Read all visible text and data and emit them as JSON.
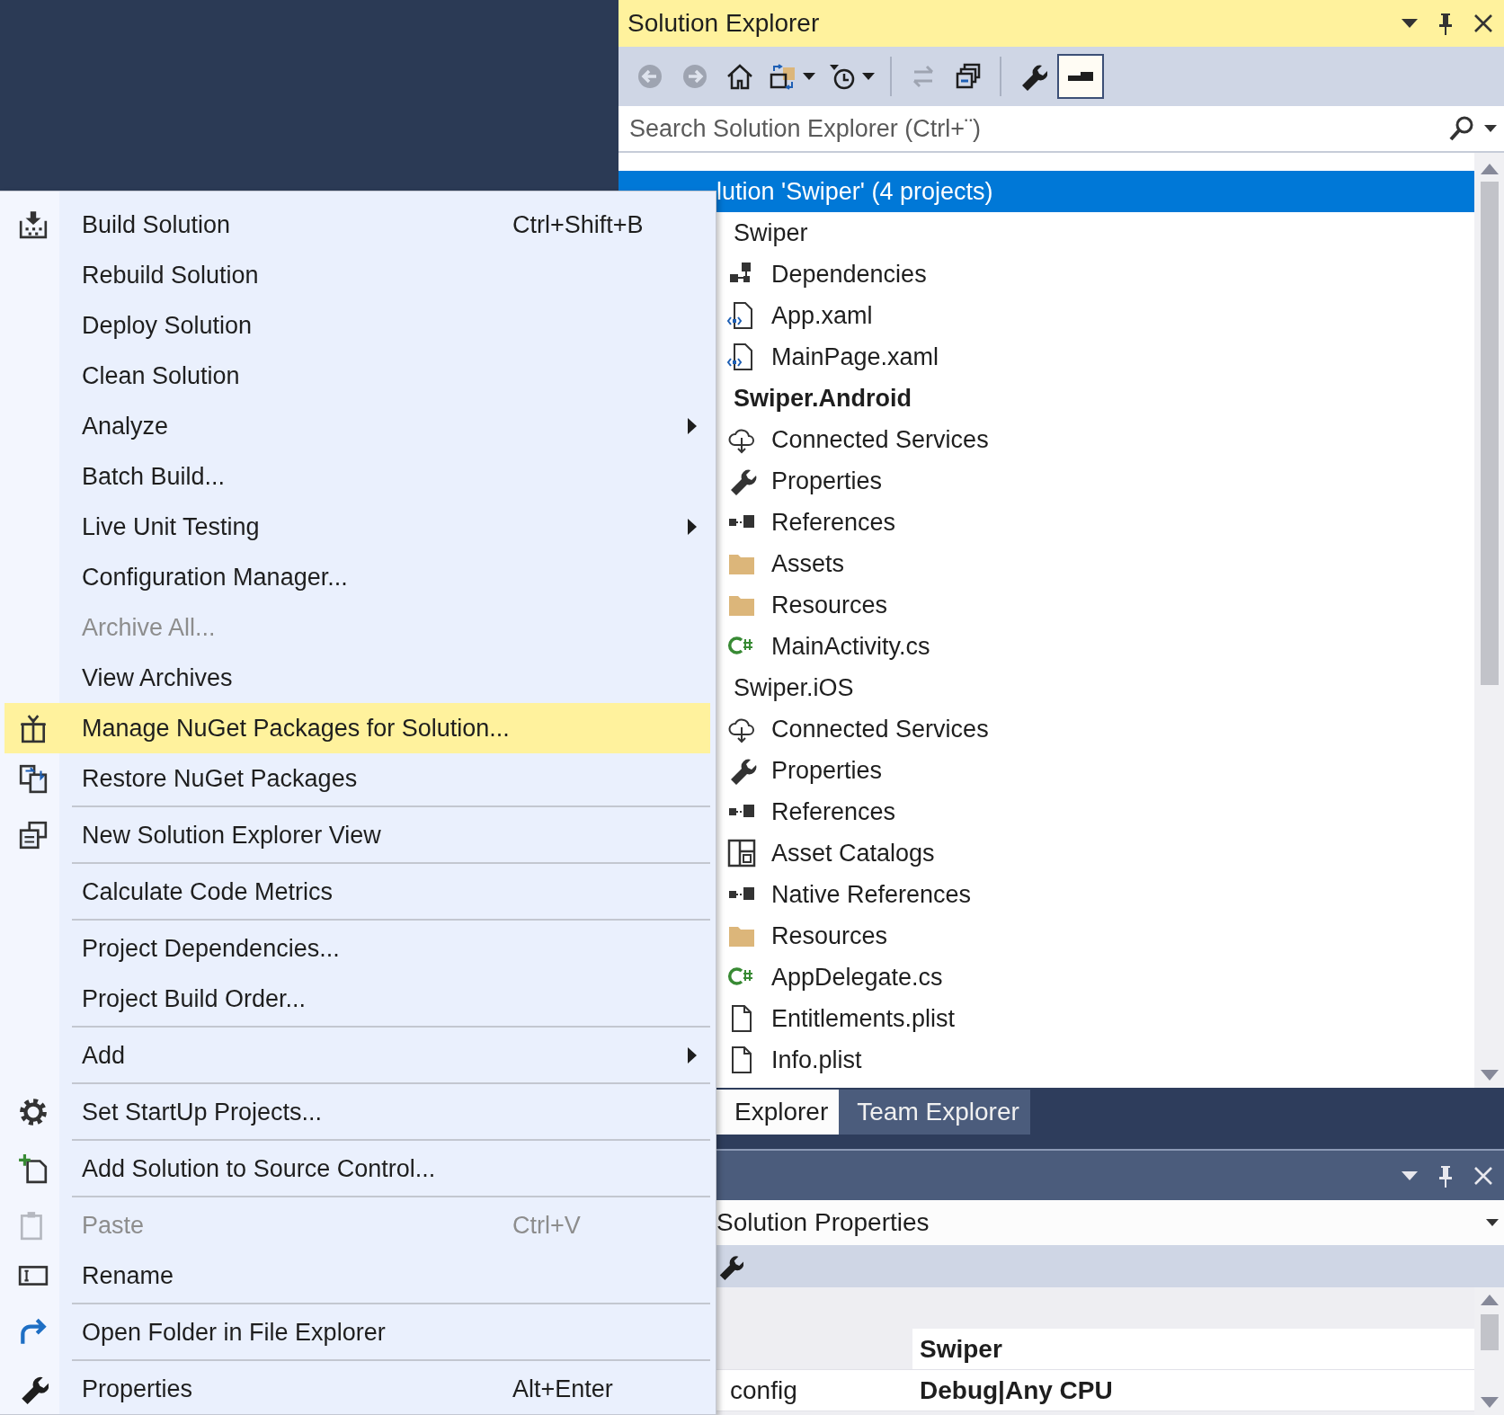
{
  "title_bar": {
    "title": "Solution Explorer"
  },
  "toolbar": [
    {
      "disabled": true,
      "on": false,
      "dropdown": false
    },
    {
      "disabled": true,
      "on": false,
      "dropdown": false
    },
    {
      "disabled": false,
      "on": false,
      "dropdown": false
    },
    {
      "disabled": false,
      "on": false,
      "dropdown": true
    },
    {
      "disabled": false,
      "on": false,
      "dropdown": true
    },
    {
      "disabled": true,
      "on": false,
      "dropdown": false
    },
    {
      "disabled": false,
      "on": false,
      "dropdown": false
    },
    {
      "disabled": false,
      "on": false,
      "dropdown": false
    },
    {
      "disabled": false,
      "on": true,
      "dropdown": false
    }
  ],
  "search": {
    "placeholder": "Search Solution Explorer (Ctrl+¨)"
  },
  "tree": [
    {
      "label": "lution 'Swiper' (4 projects)",
      "bold": false,
      "selected": true,
      "children": [
        {
          "label": "Swiper",
          "bold": false,
          "selected": false,
          "children": [
            {
              "label": "Dependencies",
              "kind": "dependencies",
              "bold": false,
              "selected": false
            },
            {
              "label": "App.xaml",
              "kind": "xaml-file",
              "bold": false,
              "selected": false
            },
            {
              "label": "MainPage.xaml",
              "kind": "xaml-file",
              "bold": false,
              "selected": false
            }
          ]
        },
        {
          "label": "Swiper.Android",
          "bold": true,
          "selected": false,
          "children": [
            {
              "label": "Connected Services",
              "kind": "connected-services",
              "bold": false,
              "selected": false
            },
            {
              "label": "Properties",
              "kind": "properties",
              "bold": false,
              "selected": false
            },
            {
              "label": "References",
              "kind": "references",
              "bold": false,
              "selected": false
            },
            {
              "label": "Assets",
              "kind": "folder",
              "bold": false,
              "selected": false
            },
            {
              "label": "Resources",
              "kind": "folder",
              "bold": false,
              "selected": false
            },
            {
              "label": "MainActivity.cs",
              "kind": "csharp-file",
              "bold": false,
              "selected": false
            }
          ]
        },
        {
          "label": "Swiper.iOS",
          "bold": false,
          "selected": false,
          "children": [
            {
              "label": "Connected Services",
              "kind": "connected-services",
              "bold": false,
              "selected": false
            },
            {
              "label": "Properties",
              "kind": "properties",
              "bold": false,
              "selected": false
            },
            {
              "label": "References",
              "kind": "references",
              "bold": false,
              "selected": false
            },
            {
              "label": "Asset Catalogs",
              "kind": "asset-catalog",
              "bold": false,
              "selected": false
            },
            {
              "label": "Native References",
              "kind": "references",
              "bold": false,
              "selected": false
            },
            {
              "label": "Resources",
              "kind": "folder",
              "bold": false,
              "selected": false
            },
            {
              "label": "AppDelegate.cs",
              "kind": "csharp-file",
              "bold": false,
              "selected": false
            },
            {
              "label": "Entitlements.plist",
              "kind": "file",
              "bold": false,
              "selected": false
            },
            {
              "label": "Info.plist",
              "kind": "file",
              "bold": false,
              "selected": false
            }
          ]
        }
      ]
    }
  ],
  "bottom_tabs": [
    {
      "label": "Explorer",
      "selected": true
    },
    {
      "label": "Team Explorer",
      "selected": false
    }
  ],
  "properties": {
    "object": "Solution Properties",
    "rows": [
      {
        "value": "Swiper"
      },
      {
        "name": "config",
        "value": "Debug|Any CPU"
      }
    ]
  },
  "context_menu": [
    {
      "kind": "command",
      "label": "Build Solution",
      "shortcut": "Ctrl+Shift+B",
      "submenu": false,
      "disabled": false,
      "selected": false
    },
    {
      "kind": "command",
      "label": "Rebuild Solution",
      "submenu": false,
      "disabled": false,
      "selected": false
    },
    {
      "kind": "command",
      "label": "Deploy Solution",
      "submenu": false,
      "disabled": false,
      "selected": false
    },
    {
      "kind": "command",
      "label": "Clean Solution",
      "submenu": false,
      "disabled": false,
      "selected": false
    },
    {
      "kind": "command",
      "label": "Analyze",
      "submenu": true,
      "disabled": false,
      "selected": false
    },
    {
      "kind": "command",
      "label": "Batch Build...",
      "submenu": false,
      "disabled": false,
      "selected": false
    },
    {
      "kind": "command",
      "label": "Live Unit Testing",
      "submenu": true,
      "disabled": false,
      "selected": false
    },
    {
      "kind": "command",
      "label": "Configuration Manager...",
      "submenu": false,
      "disabled": false,
      "selected": false
    },
    {
      "kind": "command",
      "label": "Archive All...",
      "submenu": false,
      "disabled": true,
      "selected": false
    },
    {
      "kind": "command",
      "label": "View Archives",
      "submenu": false,
      "disabled": false,
      "selected": false
    },
    {
      "kind": "command",
      "label": "Manage NuGet Packages for Solution...",
      "submenu": false,
      "disabled": false,
      "selected": true
    },
    {
      "kind": "command",
      "label": "Restore NuGet Packages",
      "submenu": false,
      "disabled": false,
      "selected": false
    },
    {
      "kind": "separator"
    },
    {
      "kind": "command",
      "label": "New Solution Explorer View",
      "submenu": false,
      "disabled": false,
      "selected": false
    },
    {
      "kind": "separator"
    },
    {
      "kind": "command",
      "label": "Calculate Code Metrics",
      "submenu": false,
      "disabled": false,
      "selected": false
    },
    {
      "kind": "separator"
    },
    {
      "kind": "command",
      "label": "Project Dependencies...",
      "submenu": false,
      "disabled": false,
      "selected": false
    },
    {
      "kind": "command",
      "label": "Project Build Order...",
      "submenu": false,
      "disabled": false,
      "selected": false
    },
    {
      "kind": "separator"
    },
    {
      "kind": "command",
      "label": "Add",
      "submenu": true,
      "disabled": false,
      "selected": false
    },
    {
      "kind": "separator"
    },
    {
      "kind": "command",
      "label": "Set StartUp Projects...",
      "submenu": false,
      "disabled": false,
      "selected": false
    },
    {
      "kind": "separator"
    },
    {
      "kind": "command",
      "label": "Add Solution to Source Control...",
      "submenu": false,
      "disabled": false,
      "selected": false
    },
    {
      "kind": "separator"
    },
    {
      "kind": "command",
      "label": "Paste",
      "shortcut": "Ctrl+V",
      "submenu": false,
      "disabled": true,
      "selected": false
    },
    {
      "kind": "command",
      "label": "Rename",
      "submenu": false,
      "disabled": false,
      "selected": false
    },
    {
      "kind": "separator"
    },
    {
      "kind": "command",
      "label": "Open Folder in File Explorer",
      "submenu": false,
      "disabled": false,
      "selected": false
    },
    {
      "kind": "separator"
    },
    {
      "kind": "command",
      "label": "Properties",
      "shortcut": "Alt+Enter",
      "submenu": false,
      "disabled": false,
      "selected": false
    }
  ]
}
